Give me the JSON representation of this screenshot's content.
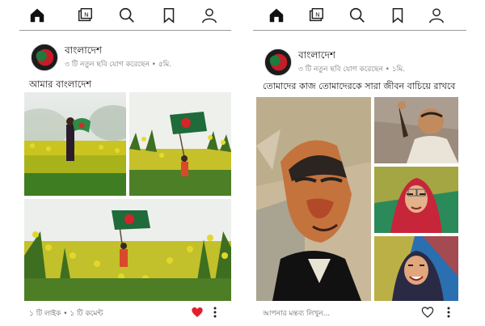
{
  "left_screen": {
    "nav": {
      "icons": [
        "home-icon",
        "news-icon",
        "search-icon",
        "bookmark-icon",
        "profile-icon"
      ],
      "active": "home-icon"
    },
    "post": {
      "author": "বাংলাদেশ",
      "meta": "৩ টি নতুন ছবি যোগ করেছেন • ৫মি.",
      "caption": "আমার বাংলাদেশ",
      "likes_label": "১ টি লাইক",
      "comments_label": "১ টি কমেন্ট",
      "separator": "•",
      "liked": true,
      "like_color": "#e0202c"
    }
  },
  "right_screen": {
    "nav": {
      "icons": [
        "home-icon",
        "news-icon",
        "search-icon",
        "bookmark-icon",
        "profile-icon"
      ],
      "active": "home-icon"
    },
    "post": {
      "author": "বাংলাদেশ",
      "meta": "৩ টি নতুন ছবি যোগ করেছেন • ১মি.",
      "caption": "তোমাদের কাজ তোমাদেরকে সারা জীবন বাচিয়ে রাখবে",
      "comment_placeholder": "আপনার মন্তব্য লিখুন...",
      "liked": false
    }
  },
  "colors": {
    "flag_green": "#1f6b3a",
    "flag_red": "#d6242b",
    "mustard": "#d9c92a"
  }
}
